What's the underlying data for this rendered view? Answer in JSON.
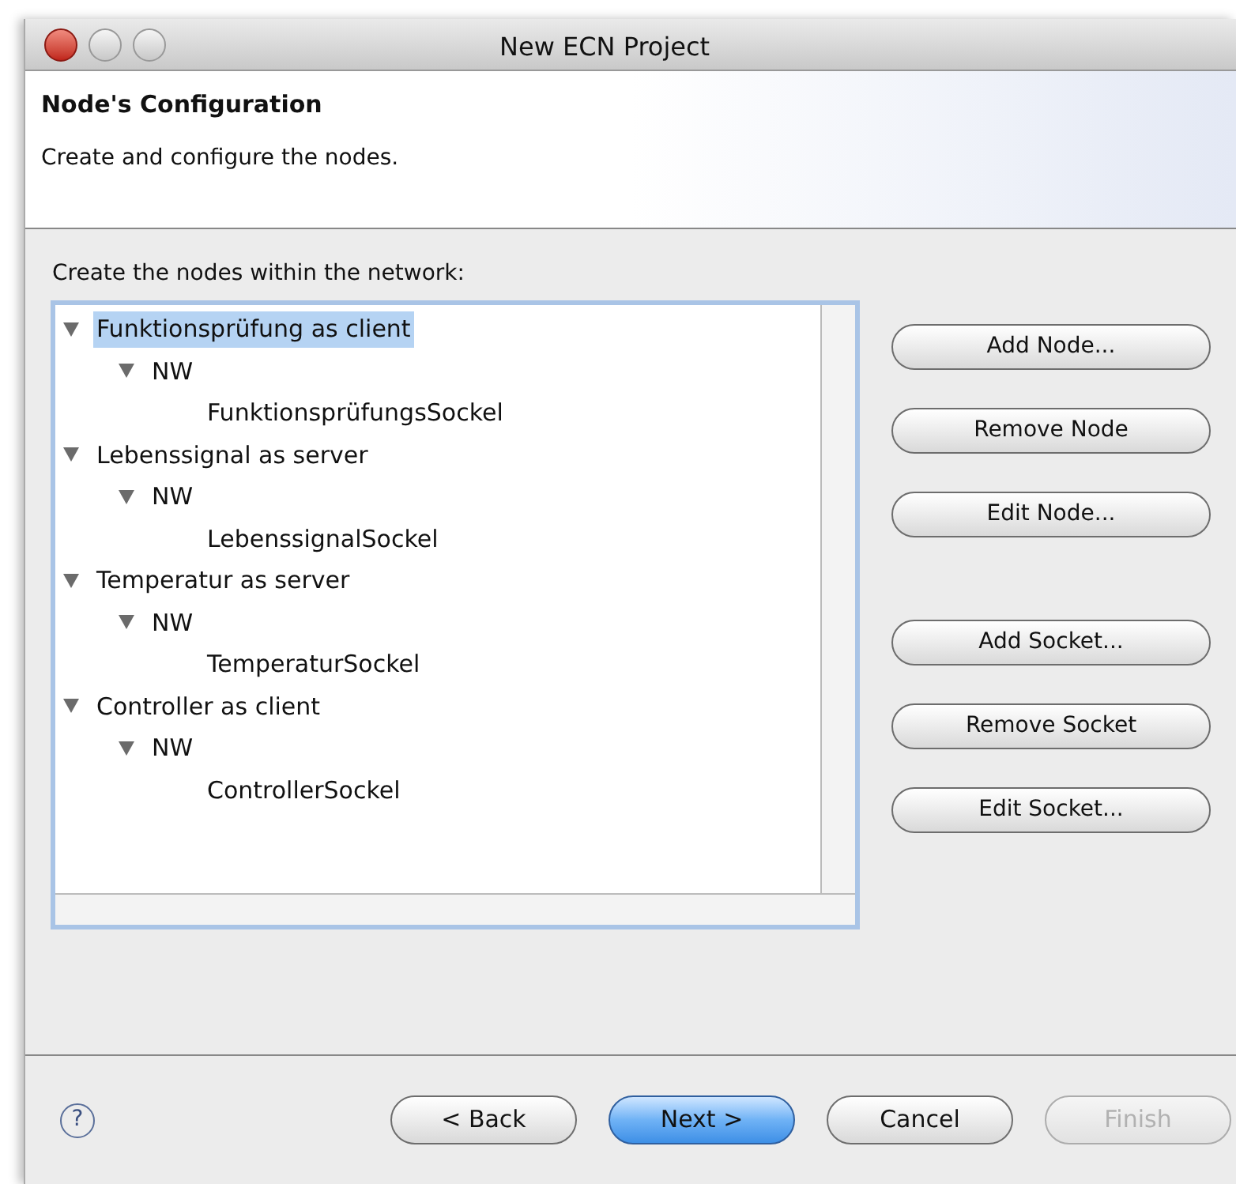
{
  "window": {
    "title": "New ECN Project"
  },
  "header": {
    "title": "Node's Configuration",
    "description": "Create and configure the nodes."
  },
  "tree_label": "Create the nodes within the network:",
  "tree": [
    {
      "label": "Funktionsprüfung as client",
      "expanded": true,
      "selected": true,
      "children": [
        {
          "label": "NW",
          "expanded": true,
          "selected": false,
          "children": [
            {
              "label": "FunktionsprüfungsSockel",
              "selected": false
            }
          ]
        }
      ]
    },
    {
      "label": "Lebenssignal as server",
      "expanded": true,
      "selected": false,
      "children": [
        {
          "label": "NW",
          "expanded": true,
          "selected": false,
          "children": [
            {
              "label": "LebenssignalSockel",
              "selected": false
            }
          ]
        }
      ]
    },
    {
      "label": "Temperatur as server",
      "expanded": true,
      "selected": false,
      "children": [
        {
          "label": "NW",
          "expanded": true,
          "selected": false,
          "children": [
            {
              "label": "TemperaturSockel",
              "selected": false
            }
          ]
        }
      ]
    },
    {
      "label": "Controller as client",
      "expanded": true,
      "selected": false,
      "children": [
        {
          "label": "NW",
          "expanded": true,
          "selected": false,
          "children": [
            {
              "label": "ControllerSockel",
              "selected": false
            }
          ]
        }
      ]
    }
  ],
  "node_buttons": [
    "Add Node...",
    "Remove Node",
    "Edit Node..."
  ],
  "socket_buttons": [
    "Add Socket...",
    "Remove Socket",
    "Edit Socket..."
  ],
  "help_icon": "?",
  "footer_buttons": [
    {
      "label": "< Back",
      "kind": "normal",
      "disabled": false
    },
    {
      "label": "Next >",
      "kind": "default",
      "disabled": false
    },
    {
      "label": "Cancel",
      "kind": "normal",
      "disabled": false
    },
    {
      "label": "Finish",
      "kind": "normal",
      "disabled": true
    }
  ]
}
